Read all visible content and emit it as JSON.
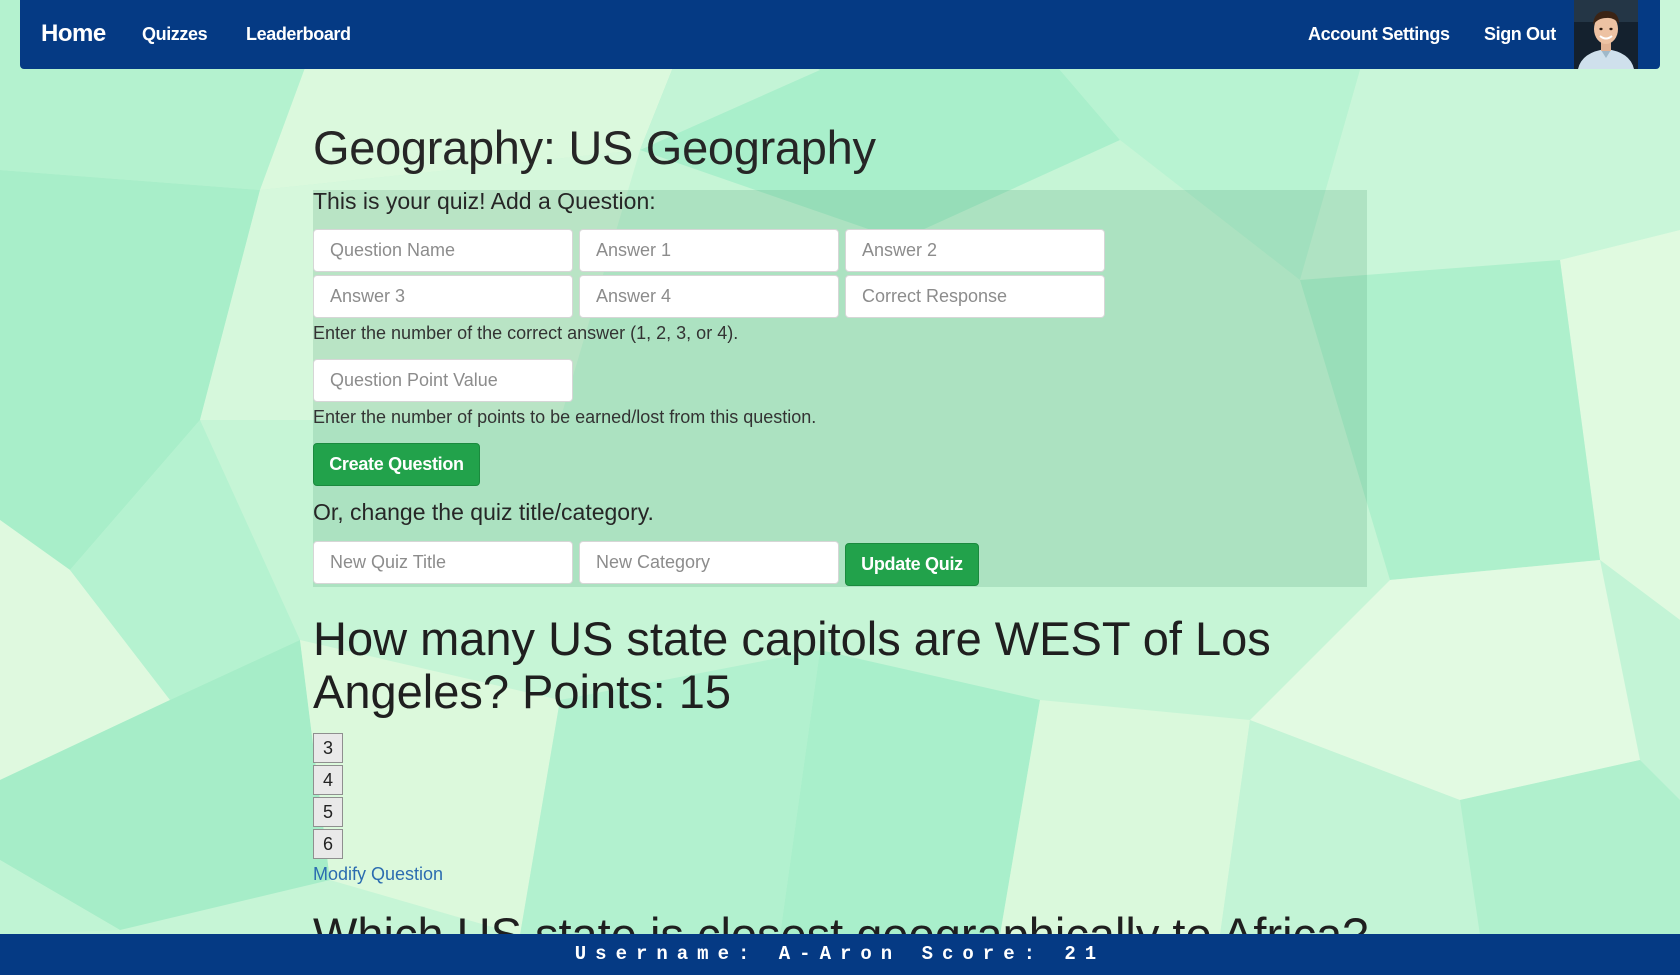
{
  "nav": {
    "brand": "Home",
    "links": [
      "Quizzes",
      "Leaderboard"
    ],
    "account_settings": "Account Settings",
    "sign_out": "Sign Out"
  },
  "quiz": {
    "title": "Geography: US Geography",
    "intro": "This is your quiz! Add a Question:",
    "fields": {
      "question_name": "Question Name",
      "answer1": "Answer 1",
      "answer2": "Answer 2",
      "answer3": "Answer 3",
      "answer4": "Answer 4",
      "correct_response": "Correct Response",
      "point_value": "Question Point Value",
      "new_title": "New Quiz Title",
      "new_category": "New Category"
    },
    "help_correct": "Enter the number of the correct answer (1, 2, 3, or 4).",
    "help_points": "Enter the number of points to be earned/lost from this question.",
    "create_button": "Create Question",
    "change_prompt": "Or, change the quiz title/category.",
    "update_button": "Update Quiz"
  },
  "questions": [
    {
      "text": "How many US state capitols are WEST of Los Angeles? Points: 15",
      "answers": [
        "3",
        "4",
        "5",
        "6"
      ],
      "modify_link": "Modify Question"
    },
    {
      "text": "Which US state is closest geographically to Africa?"
    }
  ],
  "footer": {
    "text": "Username: A-Aron Score: 21"
  },
  "colors": {
    "nav_bg": "#053a84",
    "button_green": "#22a24b",
    "link_blue": "#2b6cb0",
    "background_mint": "#c8f5d8"
  }
}
